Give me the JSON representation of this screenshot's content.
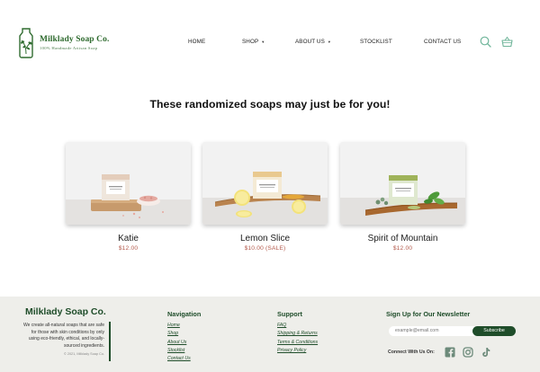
{
  "brand": {
    "name": "Milklady Soap Co.",
    "tagline": "100% Handmade Artisan Soap",
    "accent": "#2f6b2f"
  },
  "nav": {
    "items": [
      {
        "label": "HOME",
        "has_caret": false
      },
      {
        "label": "SHOP",
        "has_caret": true
      },
      {
        "label": "ABOUT US",
        "has_caret": true
      },
      {
        "label": "STOCKLIST",
        "has_caret": false
      },
      {
        "label": "CONTACT US",
        "has_caret": false
      }
    ],
    "icons": [
      "search-icon",
      "basket-icon"
    ],
    "icon_color": "#6fb59a"
  },
  "main": {
    "headline": "These randomized soaps may just be for you!",
    "products": [
      {
        "name": "Katie",
        "price": "$12.00"
      },
      {
        "name": "Lemon Slice",
        "price": "$10.00 (SALE)"
      },
      {
        "name": "Spirit of Mountain",
        "price": "$12.00"
      }
    ],
    "price_color": "#b35a4c"
  },
  "footer": {
    "brand": "Milklady Soap Co.",
    "description": "We create all-natural soaps that are safe for those with skin conditions by only using eco-friendly, ethical, and locally-sourced ingredients.",
    "copyright": "© 2021, Milklady Soap Co.",
    "navigation": {
      "title": "Navigation",
      "links": [
        "Home",
        "Shop",
        "About Us",
        "Stocklist",
        "Contact Us"
      ]
    },
    "support": {
      "title": "Support",
      "links": [
        "FAQ",
        "Shipping & Returns",
        "Terms & Conditions",
        "Privacy Policy"
      ]
    },
    "newsletter": {
      "title": "Sign Up for Our Newsletter",
      "placeholder": "example@email.com",
      "button": "Subscribe",
      "connect_label": "Connect With Us On:",
      "social_icons": [
        "facebook-icon",
        "instagram-icon",
        "tiktok-icon"
      ]
    },
    "background": "#eeeeea",
    "accent": "#1f4d2a"
  }
}
